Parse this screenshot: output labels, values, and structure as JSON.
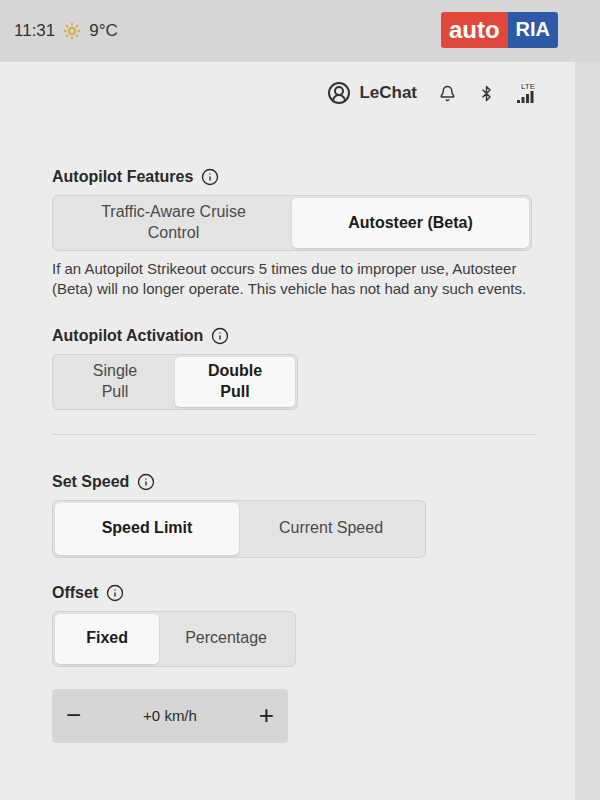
{
  "status_bar": {
    "time": "11:31",
    "temperature": "9°C"
  },
  "watermark": {
    "brand": "auto",
    "suffix": "RIA"
  },
  "profile": {
    "name": "LeChat",
    "network": "LTE"
  },
  "autopilot_features": {
    "title": "Autopilot Features",
    "options": [
      {
        "label": "Traffic-Aware Cruise Control",
        "selected": false
      },
      {
        "label": "Autosteer (Beta)",
        "selected": true
      }
    ],
    "note": "If an Autopilot Strikeout occurs 5 times due to improper use, Autosteer (Beta) will no longer operate. This vehicle has not had any such events."
  },
  "autopilot_activation": {
    "title": "Autopilot Activation",
    "options": [
      {
        "label": "Single Pull",
        "selected": false
      },
      {
        "label": "Double Pull",
        "selected": true
      }
    ]
  },
  "set_speed": {
    "title": "Set Speed",
    "options": [
      {
        "label": "Speed Limit",
        "selected": true
      },
      {
        "label": "Current Speed",
        "selected": false
      }
    ]
  },
  "offset": {
    "title": "Offset",
    "options": [
      {
        "label": "Fixed",
        "selected": true
      },
      {
        "label": "Percentage",
        "selected": false
      }
    ]
  },
  "stepper": {
    "minus": "−",
    "value": "+0 km/h",
    "plus": "+"
  }
}
